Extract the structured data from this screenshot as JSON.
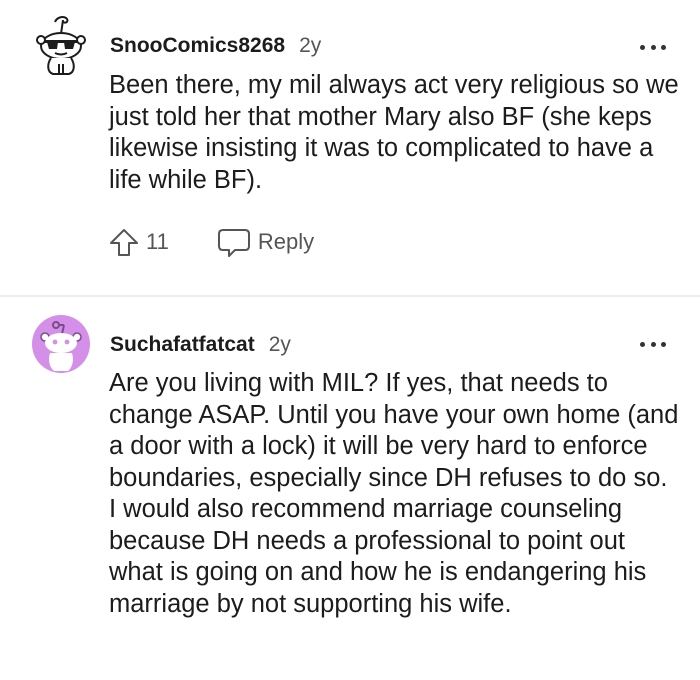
{
  "comments": [
    {
      "username": "SnooComics8268",
      "age": "2y",
      "avatar_icon": "snoo-sunglasses-avatar-icon",
      "text": "Been there, my mil always act very religious so we just told her that mother Mary also BF (she keps likewise insisting it was to complicated to have a life while BF).",
      "upvotes": "11",
      "reply_label": "Reply"
    },
    {
      "username": "Suchafatfatcat",
      "age": "2y",
      "avatar_icon": "snoo-purple-avatar-icon",
      "avatar_color": "#d48fe8",
      "text": "Are you living with MIL? If yes, that needs to change ASAP. Until you have your own home (and a door with a lock) it will be very hard to enforce boundaries, especially since DH refuses to do so. I would also recommend marriage counseling because DH needs a professional to point out what is going on and how he is endangering his marriage by not supporting his wife."
    }
  ]
}
